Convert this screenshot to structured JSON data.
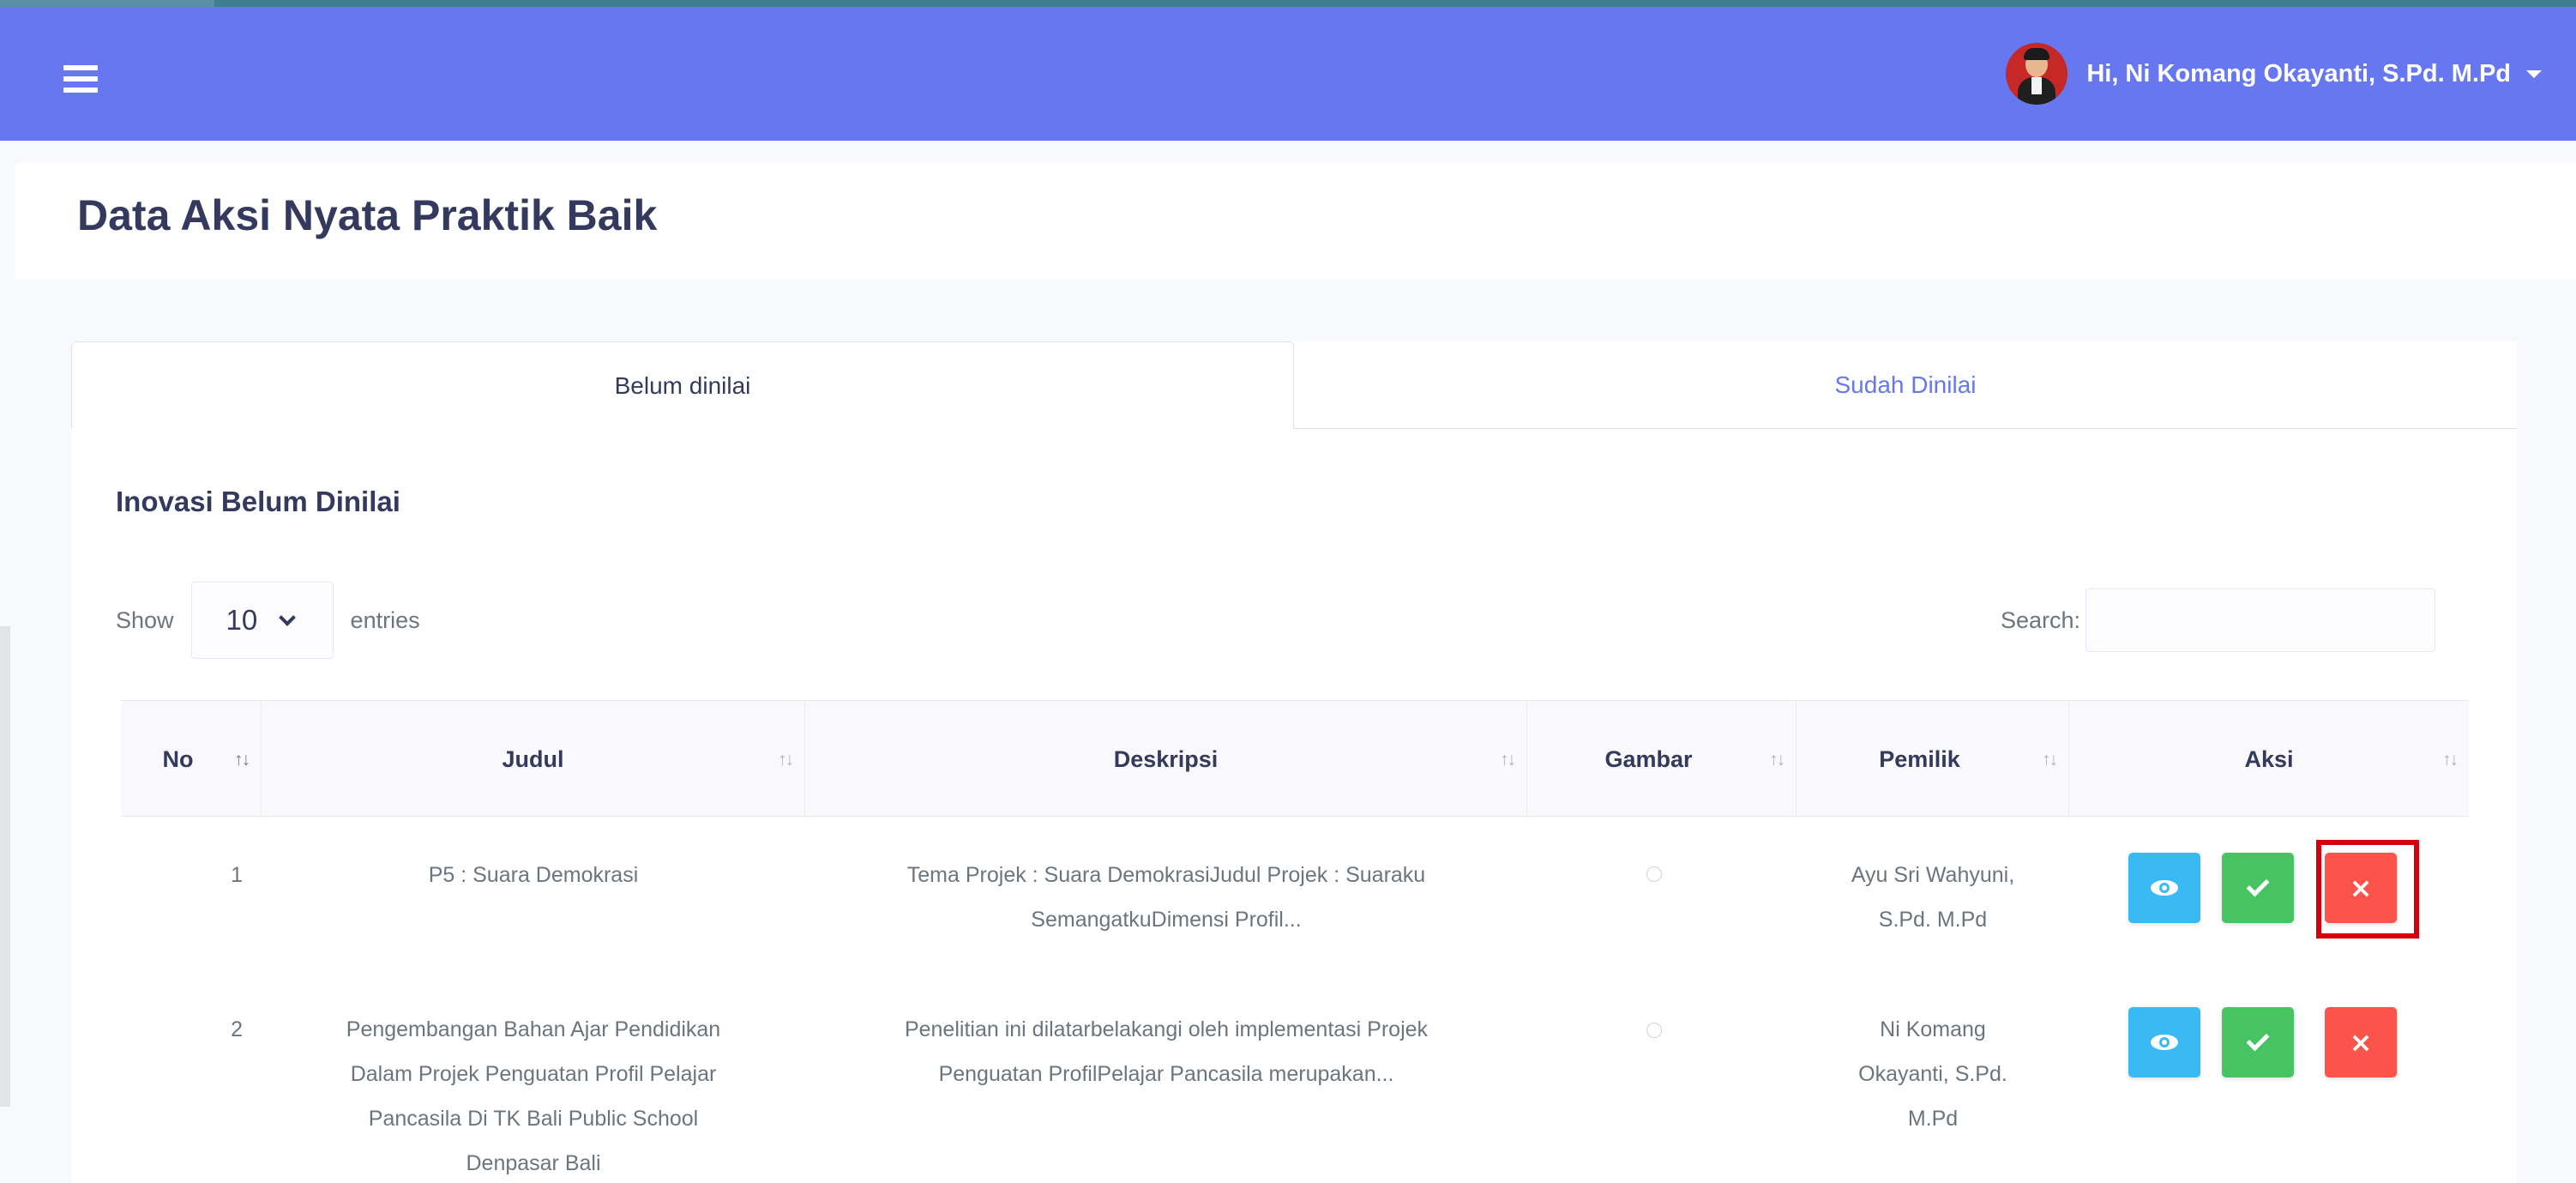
{
  "topbar": {
    "menu_icon": "hamburger-menu-icon",
    "greeting": "Hi, Ni Komang Okayanti, S.Pd. M.Pd",
    "accent": "#6777ef"
  },
  "page": {
    "title": "Data Aksi Nyata Praktik Baik"
  },
  "tabs": [
    {
      "label": "Belum dinilai",
      "active": true
    },
    {
      "label": "Sudah Dinilai",
      "active": false
    }
  ],
  "section": {
    "title": "Inovasi Belum Dinilai"
  },
  "datatable": {
    "show_label": "Show",
    "entries_value": "10",
    "entries_label": "entries",
    "search_label": "Search:",
    "search_value": ""
  },
  "table": {
    "columns": [
      "No",
      "Judul",
      "Deskripsi",
      "Gambar",
      "Pemilik",
      "Aksi"
    ],
    "rows": [
      {
        "no": "1",
        "judul": [
          "P5 : Suara Demokrasi"
        ],
        "deskripsi": [
          "Tema Projek : Suara DemokrasiJudul Projek : Suaraku",
          "SemangatkuDimensi Profil..."
        ],
        "pemilik": [
          "Ayu Sri Wahyuni,",
          "S.Pd. M.Pd"
        ]
      },
      {
        "no": "2",
        "judul": [
          "Pengembangan Bahan Ajar Pendidikan",
          "Dalam Projek Penguatan Profil Pelajar",
          "Pancasila Di TK Bali Public School",
          "Denpasar Bali"
        ],
        "deskripsi": [
          "Penelitian ini dilatarbelakangi oleh implementasi Projek",
          "Penguatan ProfilPelajar Pancasila merupakan..."
        ],
        "pemilik": [
          "Ni Komang",
          "Okayanti, S.Pd.",
          "M.Pd"
        ]
      }
    ],
    "actions": [
      "eye-icon",
      "check-icon",
      "times-icon"
    ]
  },
  "colors": {
    "info": "#3abaf4",
    "success": "#47c363",
    "danger": "#fc544b",
    "highlight": "#d5000b"
  }
}
